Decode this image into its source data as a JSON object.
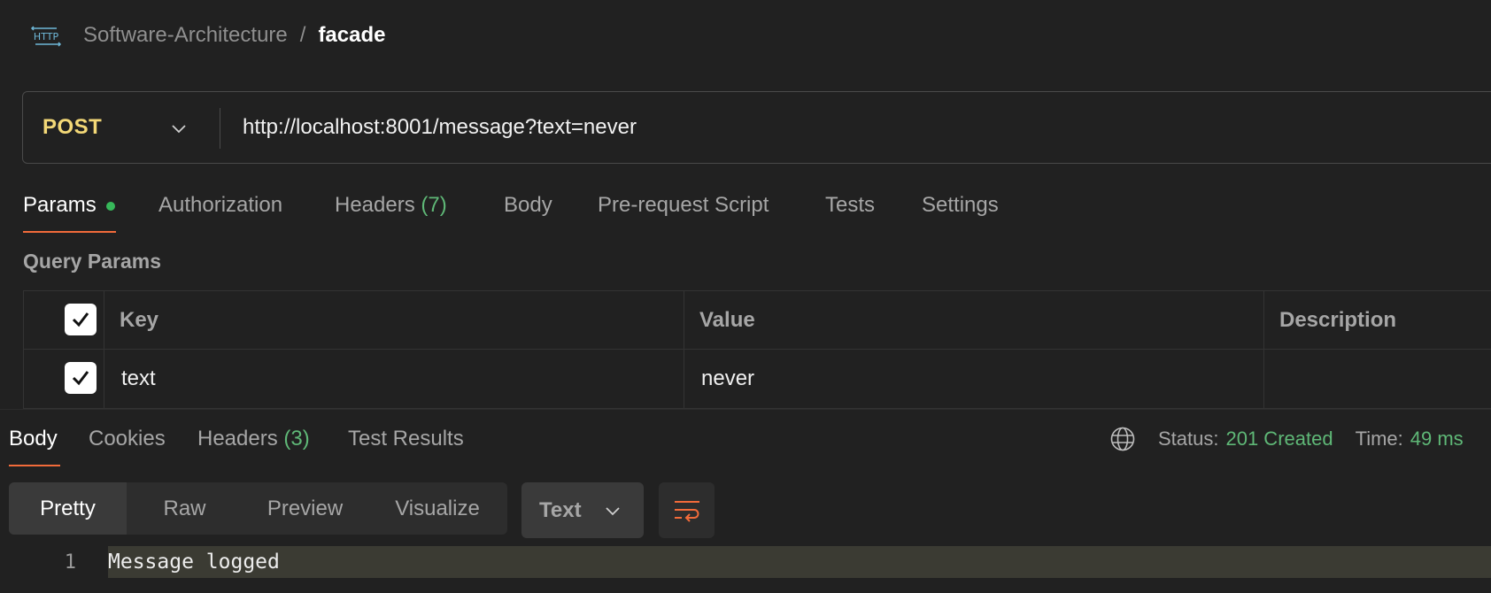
{
  "header": {
    "icon": "http-icon",
    "breadcrumb_parent": "Software-Architecture",
    "breadcrumb_separator": "/",
    "breadcrumb_current": "facade"
  },
  "request": {
    "method": "POST",
    "url": "http://localhost:8001/message?text=never",
    "tabs": [
      {
        "label": "Params",
        "active": true,
        "has_indicator": true
      },
      {
        "label": "Authorization"
      },
      {
        "label": "Headers",
        "count": "(7)"
      },
      {
        "label": "Body"
      },
      {
        "label": "Pre-request Script"
      },
      {
        "label": "Tests"
      },
      {
        "label": "Settings"
      }
    ]
  },
  "query_params": {
    "title": "Query Params",
    "columns": [
      "Key",
      "Value",
      "Description"
    ],
    "rows": [
      {
        "enabled": true,
        "key": "text",
        "value": "never",
        "description": ""
      }
    ]
  },
  "response": {
    "tabs": [
      {
        "label": "Body",
        "active": true
      },
      {
        "label": "Cookies"
      },
      {
        "label": "Headers",
        "count": "(3)"
      },
      {
        "label": "Test Results"
      }
    ],
    "status_label": "Status:",
    "status_value": "201 Created",
    "time_label": "Time:",
    "time_value": "49 ms",
    "view_modes": [
      "Pretty",
      "Raw",
      "Preview",
      "Visualize"
    ],
    "active_view_mode": "Pretty",
    "format": "Text",
    "body_lines": [
      {
        "number": "1",
        "text": "Message logged"
      }
    ]
  },
  "colors": {
    "background": "#212121",
    "method": "#f3d877",
    "accent_underline": "#f26b3a",
    "success": "#5fb877",
    "indicator_dot": "#37b85a",
    "highlight_line": "#3b3b33"
  }
}
